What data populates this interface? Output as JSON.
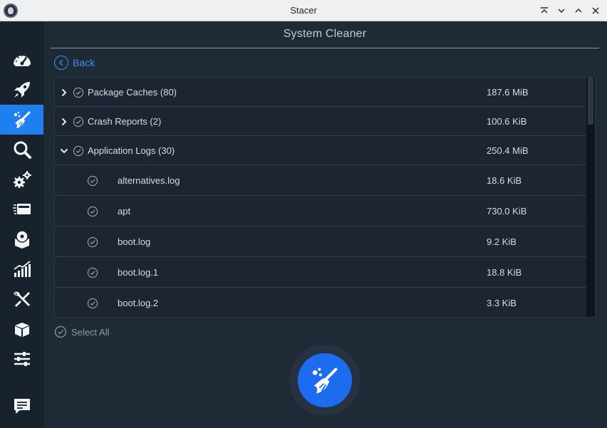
{
  "window": {
    "title": "Stacer",
    "controls": [
      "keep-above-icon",
      "minimize-icon",
      "maximize-icon",
      "close-icon"
    ]
  },
  "sidebar": {
    "items": [
      {
        "name": "dashboard",
        "icon": "speedometer-icon",
        "active": false
      },
      {
        "name": "startup-apps",
        "icon": "rocket-icon",
        "active": false
      },
      {
        "name": "system-cleaner",
        "icon": "broom-icon",
        "active": true
      },
      {
        "name": "search",
        "icon": "magnifier-icon",
        "active": false
      },
      {
        "name": "services",
        "icon": "gears-icon",
        "active": false
      },
      {
        "name": "processes",
        "icon": "processes-icon",
        "active": false
      },
      {
        "name": "uninstaller",
        "icon": "disc-box-icon",
        "active": false
      },
      {
        "name": "resources",
        "icon": "chart-icon",
        "active": false
      },
      {
        "name": "helpers",
        "icon": "tools-icon",
        "active": false
      },
      {
        "name": "apt-repository",
        "icon": "package-icon",
        "active": false
      },
      {
        "name": "settings",
        "icon": "sliders-icon",
        "active": false
      }
    ],
    "feedback_icon": "comment-icon"
  },
  "main": {
    "page_title": "System Cleaner",
    "back_label": "Back",
    "tree": [
      {
        "name": "Package Caches (80)",
        "size": "187.6 MiB",
        "level": 0,
        "expanded": false
      },
      {
        "name": "Crash Reports (2)",
        "size": "100.6 KiB",
        "level": 0,
        "expanded": false
      },
      {
        "name": "Application Logs (30)",
        "size": "250.4 MiB",
        "level": 0,
        "expanded": true
      },
      {
        "name": "alternatives.log",
        "size": "18.6 KiB",
        "level": 1
      },
      {
        "name": "apt",
        "size": "730.0 KiB",
        "level": 1
      },
      {
        "name": "boot.log",
        "size": "9.2 KiB",
        "level": 1
      },
      {
        "name": "boot.log.1",
        "size": "18.8 KiB",
        "level": 1
      },
      {
        "name": "boot.log.2",
        "size": "3.3 KiB",
        "level": 1
      }
    ],
    "select_all_label": "Select All",
    "clean_button_icon": "broom-icon"
  },
  "colors": {
    "accent": "#1f7ef0",
    "background": "#1f2a37",
    "sidebar": "#18222d",
    "link": "#3d8ef7"
  }
}
